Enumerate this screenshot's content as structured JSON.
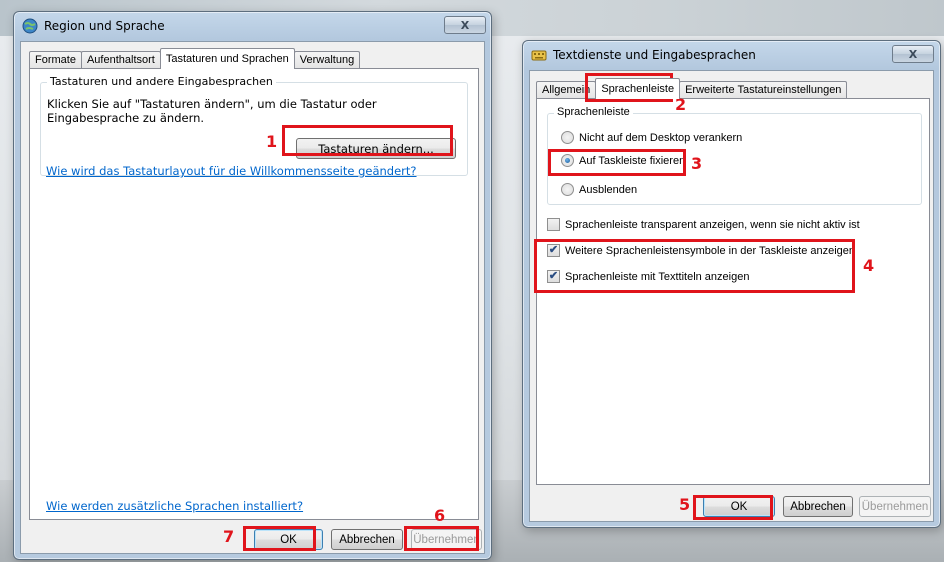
{
  "left_window": {
    "title": "Region und Sprache",
    "close_label": "X",
    "tabs": [
      {
        "label": "Formate",
        "active": false
      },
      {
        "label": "Aufenthaltsort",
        "active": false
      },
      {
        "label": "Tastaturen und Sprachen",
        "active": true
      },
      {
        "label": "Verwaltung",
        "active": false
      }
    ],
    "group_label": "Tastaturen und andere Eingabesprachen",
    "description": "Klicken Sie auf \"Tastaturen ändern\", um die Tastatur oder Eingabesprache zu ändern.",
    "change_keyboards_button": "Tastaturen ändern...",
    "welcome_link": "Wie wird das Tastaturlayout für die Willkommensseite geändert?",
    "install_languages_link": "Wie werden zusätzliche Sprachen installiert?",
    "buttons": {
      "ok": "OK",
      "cancel": "Abbrechen",
      "apply": "Übernehmen"
    }
  },
  "right_window": {
    "title": "Textdienste und Eingabesprachen",
    "close_label": "X",
    "tabs": [
      {
        "label": "Allgemein",
        "active": false
      },
      {
        "label": "Sprachenleiste",
        "active": true
      },
      {
        "label": "Erweiterte Tastatureinstellungen",
        "active": false
      }
    ],
    "group_label": "Sprachenleiste",
    "radio_options": [
      {
        "label": "Nicht auf dem Desktop verankern",
        "selected": false
      },
      {
        "label": "Auf Taskleiste fixieren",
        "selected": true
      },
      {
        "label": "Ausblenden",
        "selected": false
      }
    ],
    "checkboxes": [
      {
        "label": "Sprachenleiste transparent anzeigen, wenn sie nicht aktiv ist",
        "checked": false
      },
      {
        "label": "Weitere Sprachenleistensymbole in der Taskleiste anzeigen",
        "checked": true
      },
      {
        "label": "Sprachenleiste mit Texttiteln anzeigen",
        "checked": true
      }
    ],
    "buttons": {
      "ok": "OK",
      "cancel": "Abbrechen",
      "apply": "Übernehmen"
    }
  },
  "annotations": {
    "step1": "1",
    "step2": "2",
    "step3": "3",
    "step4": "4",
    "step5": "5",
    "step6": "6",
    "step7": "7",
    "color": "#e0141b"
  },
  "check_glyph": "✔"
}
